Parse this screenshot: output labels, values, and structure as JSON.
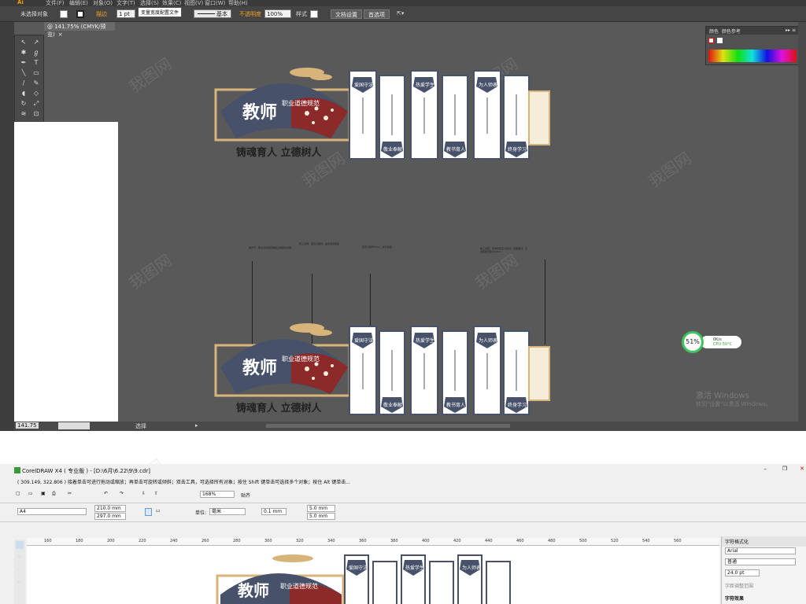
{
  "ai": {
    "menu": [
      "Ai",
      "文件(F)",
      "编辑(E)",
      "对象(O)",
      "文字(T)",
      "选择(S)",
      "效果(C)",
      "视图(V)",
      "窗口(W)",
      "帮助(H)"
    ],
    "control": {
      "no_selection": "未选择对象",
      "stroke_label": "描边",
      "stroke_value": "1 pt",
      "tooltip": "变量宽度配置文件",
      "profile": "基本",
      "opacity_label": "不透明度",
      "opacity_value": "100%",
      "style_label": "样式",
      "doc_setup": "文档设置",
      "preferences": "首选项"
    },
    "doc_tab": "@ 141.75% (CMYK/预览)",
    "status": {
      "zoom": "141.75",
      "tool": "选择"
    },
    "panel": {
      "tab1": "颜色",
      "tab2": "颜色参考"
    },
    "cpu": {
      "percent": "51%",
      "net": "0K/s",
      "temp": "CPU 50°C"
    },
    "windows": {
      "line1": "激活 Windows",
      "line2": "转到\"设置\"以激活 Windows。"
    },
    "notes": [
      "教师节，职业道德规范展板立体结构说明...",
      "施工说明：亚克力雕刻，金色烤漆铝板...",
      "亚克力板厚3mm，丝印画面...",
      "施工说明：整体用亚克力板材，底面雕刻，五层铝板安装200mm..."
    ]
  },
  "design": {
    "title": "教师",
    "subtitle": "职业道德规范",
    "slogan": "铸魂育人 立德树人",
    "top_labels": [
      "爱国守法",
      "热爱学生",
      "为人师表"
    ],
    "bottom_labels": [
      "敬业奉献",
      "教书育人",
      "终身学习"
    ]
  },
  "cdr": {
    "title": "CorelDRAW X4 ( 专业版 ) - [D:\\6月\\6.22\\9\\9.cdr]",
    "status": "( 309.149, 322.806 )    接着单击可进行拖动或缩放；再单击可旋转或倾斜；双击工具，可选择所有对象；按住 Shift 键单击可选择多个对象；按住 Alt 键单击...",
    "zoom": "168%",
    "paste": "贴齐",
    "page_size": "A4",
    "width": "210.0 mm",
    "height": "297.0 mm",
    "unit_label": "单位:",
    "unit": "毫米",
    "nudge": "0.1 mm",
    "dup_x": "5.0 mm",
    "dup_y": "5.0 mm",
    "ruler": [
      "160",
      "180",
      "200",
      "220",
      "240",
      "260",
      "280",
      "300",
      "320",
      "340",
      "360",
      "380",
      "400",
      "420",
      "440",
      "460",
      "480",
      "500",
      "520",
      "540",
      "560"
    ],
    "dock": {
      "title": "字符格式化",
      "font": "Arial",
      "style": "普通",
      "size": "24.0 pt",
      "kerning": "字距调整范围",
      "effects": "字符效果"
    }
  },
  "colors": {
    "navy": "#47526a",
    "red": "#8c2a2a",
    "gold": "#d7b57a",
    "cream": "#f5ecd9",
    "green": "#3fc35c"
  }
}
